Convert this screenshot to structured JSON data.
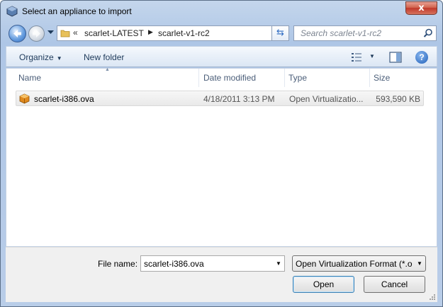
{
  "window": {
    "title": "Select an appliance to import",
    "close_label": "x"
  },
  "address": {
    "overflow_label": "«",
    "breadcrumbs": [
      "scarlet-LATEST",
      "scarlet-v1-rc2"
    ]
  },
  "search": {
    "placeholder": "Search scarlet-v1-rc2"
  },
  "toolbar": {
    "organize_label": "Organize",
    "new_folder_label": "New folder"
  },
  "file_list": {
    "columns": [
      "Name",
      "Date modified",
      "Type",
      "Size"
    ],
    "rows": [
      {
        "name": "scarlet-i386.ova",
        "date": "4/18/2011 3:13 PM",
        "type": "Open Virtualizatio...",
        "size": "593,590 KB"
      }
    ]
  },
  "bottom": {
    "file_name_label": "File name:",
    "file_name_value": "scarlet-i386.ova",
    "filter_value": "Open Virtualization Format (*.o",
    "open_label": "Open",
    "cancel_label": "Cancel"
  },
  "icons": {
    "app": "virtualbox-icon",
    "back": "back-arrow-icon",
    "forward": "forward-arrow-icon",
    "folder": "folder-icon",
    "refresh": "refresh-icon",
    "search": "search-icon",
    "views": "views-icon",
    "preview": "preview-pane-icon",
    "help": "help-icon",
    "file": "ova-package-icon"
  },
  "colors": {
    "accent": "#2e6bc3",
    "selection_row": "#e9e9e9",
    "close_button": "#c0392b"
  }
}
